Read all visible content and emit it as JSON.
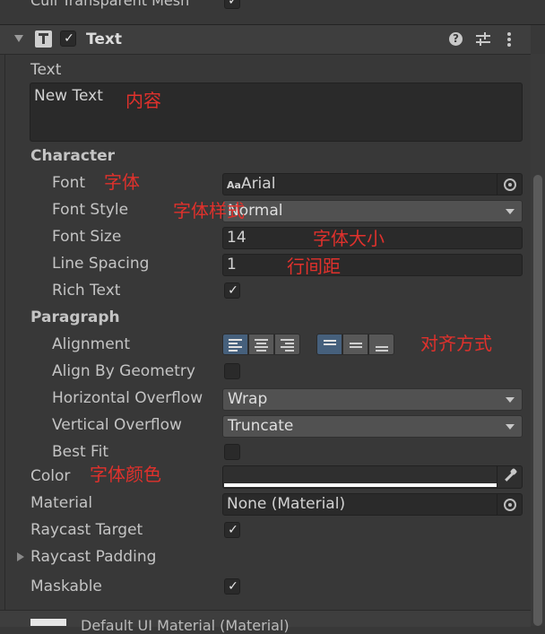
{
  "top_prev": {
    "label": "Cull Transparent Mesh",
    "checked": "✓"
  },
  "header": {
    "title": "Text",
    "enabled_check": "✓",
    "help_icon": "help-icon",
    "presets_icon": "presets-icon",
    "menu_icon": "kebab-menu-icon"
  },
  "text_field": {
    "label": "Text",
    "value": "New Text"
  },
  "character": {
    "heading": "Character",
    "font": {
      "label": "Font",
      "value": "Arial",
      "prefix": "Aa"
    },
    "font_style": {
      "label": "Font Style",
      "value": "Normal"
    },
    "font_size": {
      "label": "Font Size",
      "value": "14"
    },
    "line_spacing": {
      "label": "Line Spacing",
      "value": "1"
    },
    "rich_text": {
      "label": "Rich Text",
      "checked": "✓"
    }
  },
  "paragraph": {
    "heading": "Paragraph",
    "alignment": {
      "label": "Alignment"
    },
    "align_by_geometry": {
      "label": "Align By Geometry"
    },
    "horizontal_overflow": {
      "label": "Horizontal Overflow",
      "value": "Wrap"
    },
    "vertical_overflow": {
      "label": "Vertical Overflow",
      "value": "Truncate"
    },
    "best_fit": {
      "label": "Best Fit"
    }
  },
  "color": {
    "label": "Color",
    "value": "#ffffff"
  },
  "material": {
    "label": "Material",
    "value": "None (Material)"
  },
  "raycast_target": {
    "label": "Raycast Target",
    "checked": "✓"
  },
  "raycast_padding": {
    "label": "Raycast Padding"
  },
  "maskable": {
    "label": "Maskable",
    "checked": "✓"
  },
  "bottom_next": {
    "label": "Default UI Material (Material)"
  },
  "annotations": {
    "content": "内容",
    "font": "字体",
    "font_style": "字体样式",
    "font_size": "字体大小",
    "line_spacing": "行间距",
    "alignment": "对齐方式",
    "color": "字体颜色"
  },
  "colors": {
    "accent": "#46607c",
    "annotation": "#e0312c",
    "panel": "#383838"
  }
}
